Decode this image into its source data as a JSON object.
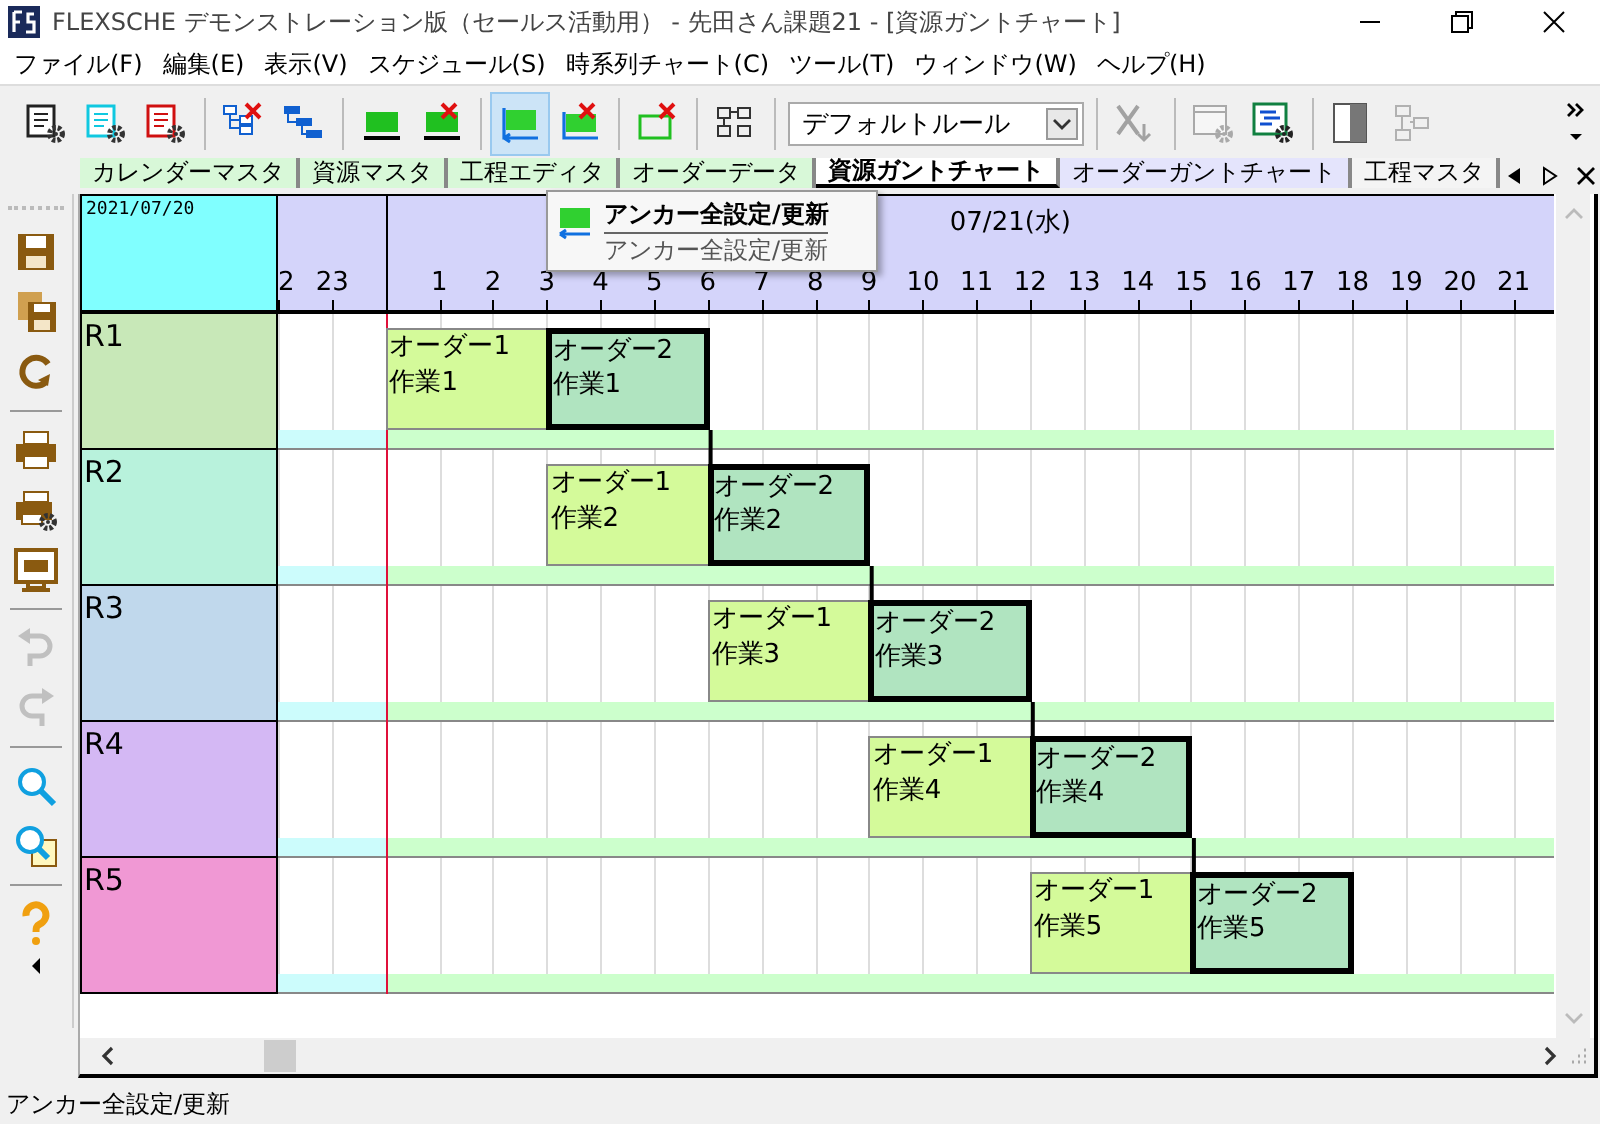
{
  "window": {
    "title": "FLEXSCHE デモンストレーション版（セールス活動用） - 先田さん課題21 - [資源ガントチャート]"
  },
  "menu": [
    "ファイル(F)",
    "編集(E)",
    "表示(V)",
    "スケジュール(S)",
    "時系列チャート(C)",
    "ツール(T)",
    "ウィンドウ(W)",
    "ヘルプ(H)"
  ],
  "toolbar": {
    "items": [
      {
        "kind": "doc-gear",
        "disabled": false,
        "highlighted": false
      },
      {
        "kind": "doc-gear-cyan",
        "disabled": false,
        "highlighted": false
      },
      {
        "kind": "doc-gear-red",
        "disabled": false,
        "highlighted": false
      },
      {
        "kind": "separator"
      },
      {
        "kind": "tree-x",
        "disabled": false,
        "highlighted": false
      },
      {
        "kind": "tree",
        "disabled": false,
        "highlighted": false
      },
      {
        "kind": "separator"
      },
      {
        "kind": "bar",
        "disabled": false,
        "highlighted": false
      },
      {
        "kind": "bar-x",
        "disabled": false,
        "highlighted": false
      },
      {
        "kind": "separator"
      },
      {
        "kind": "anchor",
        "disabled": false,
        "highlighted": true
      },
      {
        "kind": "anchor-x",
        "disabled": false,
        "highlighted": false
      },
      {
        "kind": "separator"
      },
      {
        "kind": "frame-x",
        "disabled": false,
        "highlighted": false
      },
      {
        "kind": "separator"
      },
      {
        "kind": "layout",
        "disabled": false,
        "highlighted": false
      },
      {
        "kind": "separator"
      },
      {
        "kind": "rule-select",
        "value": "デフォルトルール"
      },
      {
        "kind": "separator"
      },
      {
        "kind": "xsort",
        "disabled": true,
        "highlighted": false
      },
      {
        "kind": "separator"
      },
      {
        "kind": "window-gear",
        "disabled": true,
        "highlighted": false
      },
      {
        "kind": "gantt-gear",
        "disabled": false,
        "highlighted": false
      },
      {
        "kind": "separator"
      },
      {
        "kind": "split",
        "disabled": false,
        "highlighted": false
      },
      {
        "kind": "grid",
        "disabled": true,
        "highlighted": false
      }
    ]
  },
  "doc_tabs": [
    {
      "label": "カレンダーマスタ",
      "selected": false,
      "color": "#d8f8d8"
    },
    {
      "label": "資源マスタ",
      "selected": false,
      "color": "#d8f8d8"
    },
    {
      "label": "工程エディタ",
      "selected": false,
      "color": "#d8f8d8"
    },
    {
      "label": "オーダーデータ",
      "selected": false,
      "color": "#d8f8d8"
    },
    {
      "label": "資源ガントチャート",
      "selected": true,
      "color": "#ffffff"
    },
    {
      "label": "オーダーガントチャート",
      "selected": false,
      "color": "#e4e4fc"
    },
    {
      "label": "工程マスタ",
      "selected": false,
      "color": "#f4f4f4"
    }
  ],
  "tooltip": {
    "title": "アンカー全設定/更新",
    "description": "アンカー全設定/更新"
  },
  "side_toolbar": [
    {
      "kind": "save",
      "disabled": false
    },
    {
      "kind": "save-all",
      "disabled": false
    },
    {
      "kind": "refresh",
      "disabled": false
    },
    {
      "kind": "separator"
    },
    {
      "kind": "print",
      "disabled": false
    },
    {
      "kind": "print-setup",
      "disabled": false
    },
    {
      "kind": "print-preview",
      "disabled": false
    },
    {
      "kind": "separator"
    },
    {
      "kind": "undo",
      "disabled": true
    },
    {
      "kind": "redo",
      "disabled": true
    },
    {
      "kind": "separator"
    },
    {
      "kind": "zoom",
      "disabled": false
    },
    {
      "kind": "zoom-page",
      "disabled": false
    },
    {
      "kind": "separator"
    },
    {
      "kind": "help",
      "disabled": false
    }
  ],
  "gantt": {
    "date": "2021/07/20",
    "day_label": "07/21(水)",
    "prev_day_hours": [
      "2",
      "23"
    ],
    "day_hours": [
      "1",
      "2",
      "3",
      "4",
      "5",
      "6",
      "7",
      "8",
      "9",
      "10",
      "11",
      "12",
      "13",
      "14",
      "15",
      "16",
      "17",
      "18",
      "19",
      "20",
      "21"
    ],
    "resources": [
      {
        "name": "R1",
        "color": "#c8e8b8",
        "tasks": [
          {
            "order": "オーダー1",
            "operation": "作業1",
            "selected": false
          },
          {
            "order": "オーダー2",
            "operation": "作業1",
            "selected": true
          }
        ]
      },
      {
        "name": "R2",
        "color": "#b8f2dc",
        "tasks": [
          {
            "order": "オーダー1",
            "operation": "作業2",
            "selected": false
          },
          {
            "order": "オーダー2",
            "operation": "作業2",
            "selected": true
          }
        ]
      },
      {
        "name": "R3",
        "color": "#c0d8ec",
        "tasks": [
          {
            "order": "オーダー1",
            "operation": "作業3",
            "selected": false
          },
          {
            "order": "オーダー2",
            "operation": "作業3",
            "selected": true
          }
        ]
      },
      {
        "name": "R4",
        "color": "#d4b8f4",
        "tasks": [
          {
            "order": "オーダー1",
            "operation": "作業4",
            "selected": false
          },
          {
            "order": "オーダー2",
            "operation": "作業4",
            "selected": true
          }
        ]
      },
      {
        "name": "R5",
        "color": "#f098d4",
        "tasks": [
          {
            "order": "オーダー1",
            "operation": "作業5",
            "selected": false
          },
          {
            "order": "オーダー2",
            "operation": "作業5",
            "selected": true
          }
        ]
      }
    ]
  },
  "status_bar": {
    "text": "アンカー全設定/更新"
  }
}
